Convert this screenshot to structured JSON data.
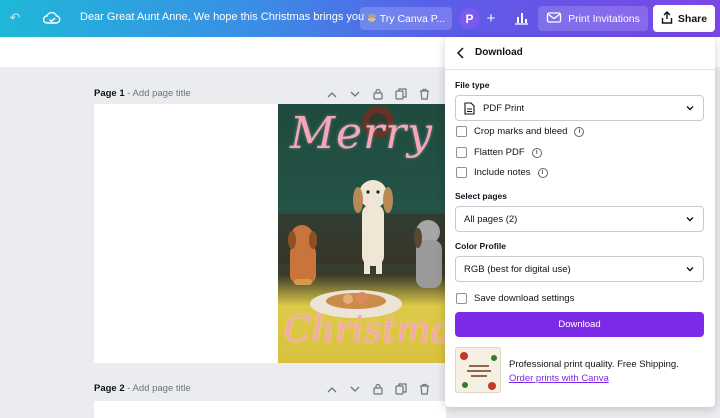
{
  "header": {
    "document_title": "Dear Great Aunt Anne, We hope this Christmas brings you ...",
    "try_canva_label": "Try Canva P...",
    "avatar_letter": "P",
    "print_invitations_label": "Print Invitations",
    "share_label": "Share"
  },
  "pages": [
    {
      "label": "Page 1",
      "sub": " - Add page title"
    },
    {
      "label": "Page 2",
      "sub": " - Add page title"
    }
  ],
  "card": {
    "top_word": "Merry",
    "bottom_word": "Christmas"
  },
  "download_panel": {
    "title": "Download",
    "file_type_label": "File type",
    "file_type_value": "PDF Print",
    "options": [
      {
        "label": "Crop marks and bleed",
        "checked": false,
        "has_info": true
      },
      {
        "label": "Flatten PDF",
        "checked": false,
        "has_info": true
      },
      {
        "label": "Include notes",
        "checked": false,
        "has_info": true
      }
    ],
    "select_pages_label": "Select pages",
    "select_pages_value": "All pages (2)",
    "color_profile_label": "Color Profile",
    "color_profile_value": "RGB (best for digital use)",
    "save_settings_label": "Save download settings",
    "download_button_label": "Download",
    "promo_text": "Professional print quality. Free Shipping.",
    "promo_link": "Order prints with Canva"
  },
  "colors": {
    "accent": "#7d2ae8",
    "card_text": "#f6a6b8"
  },
  "icons": [
    "undo-icon",
    "cloud-sync-icon",
    "crown-icon",
    "plus-icon",
    "chart-icon",
    "envelope-icon",
    "share-icon",
    "back-chevron-icon",
    "pdf-file-icon",
    "chevron-down-icon",
    "info-icon",
    "lock-icon",
    "duplicate-icon",
    "trash-icon",
    "add-page-icon"
  ]
}
